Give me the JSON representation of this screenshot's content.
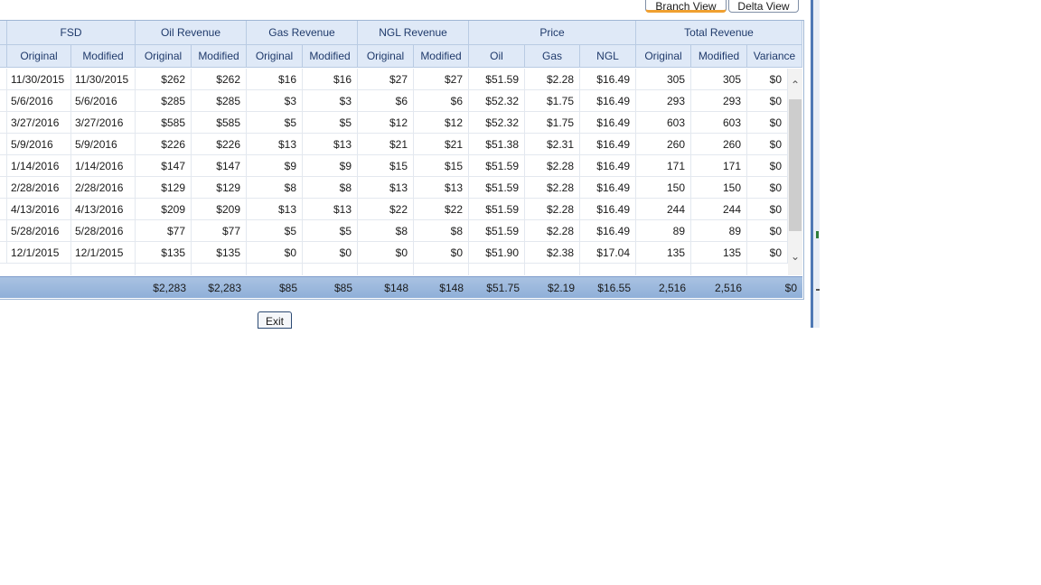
{
  "toolbar": {
    "branch_view": "Branch View",
    "delta_view": "Delta View"
  },
  "groups": [
    "FSD",
    "Oil Revenue",
    "Gas Revenue",
    "NGL Revenue",
    "Price",
    "Total Revenue"
  ],
  "subheaders": [
    "Original",
    "Modified",
    "Original",
    "Modified",
    "Original",
    "Modified",
    "Original",
    "Modified",
    "Oil",
    "Gas",
    "NGL",
    "Original",
    "Modified",
    "Variance"
  ],
  "rows": [
    [
      "11/30/2015",
      "11/30/2015",
      "$262",
      "$262",
      "$16",
      "$16",
      "$27",
      "$27",
      "$51.59",
      "$2.28",
      "$16.49",
      "305",
      "305",
      "$0"
    ],
    [
      "5/6/2016",
      "5/6/2016",
      "$285",
      "$285",
      "$3",
      "$3",
      "$6",
      "$6",
      "$52.32",
      "$1.75",
      "$16.49",
      "293",
      "293",
      "$0"
    ],
    [
      "3/27/2016",
      "3/27/2016",
      "$585",
      "$585",
      "$5",
      "$5",
      "$12",
      "$12",
      "$52.32",
      "$1.75",
      "$16.49",
      "603",
      "603",
      "$0"
    ],
    [
      "5/9/2016",
      "5/9/2016",
      "$226",
      "$226",
      "$13",
      "$13",
      "$21",
      "$21",
      "$51.38",
      "$2.31",
      "$16.49",
      "260",
      "260",
      "$0"
    ],
    [
      "1/14/2016",
      "1/14/2016",
      "$147",
      "$147",
      "$9",
      "$9",
      "$15",
      "$15",
      "$51.59",
      "$2.28",
      "$16.49",
      "171",
      "171",
      "$0"
    ],
    [
      "2/28/2016",
      "2/28/2016",
      "$129",
      "$129",
      "$8",
      "$8",
      "$13",
      "$13",
      "$51.59",
      "$2.28",
      "$16.49",
      "150",
      "150",
      "$0"
    ],
    [
      "4/13/2016",
      "4/13/2016",
      "$209",
      "$209",
      "$13",
      "$13",
      "$22",
      "$22",
      "$51.59",
      "$2.28",
      "$16.49",
      "244",
      "244",
      "$0"
    ],
    [
      "5/28/2016",
      "5/28/2016",
      "$77",
      "$77",
      "$5",
      "$5",
      "$8",
      "$8",
      "$51.59",
      "$2.28",
      "$16.49",
      "89",
      "89",
      "$0"
    ],
    [
      "12/1/2015",
      "12/1/2015",
      "$135",
      "$135",
      "$0",
      "$0",
      "$0",
      "$0",
      "$51.90",
      "$2.38",
      "$17.04",
      "135",
      "135",
      "$0"
    ]
  ],
  "totals": [
    "",
    "",
    "$2,283",
    "$2,283",
    "$85",
    "$85",
    "$148",
    "$148",
    "$51.75",
    "$2.19",
    "$16.55",
    "2,516",
    "2,516",
    "$0"
  ],
  "exit_label": "Exit",
  "icons": {
    "scroll_up": "chevron-up-icon",
    "scroll_down": "chevron-down-icon"
  }
}
